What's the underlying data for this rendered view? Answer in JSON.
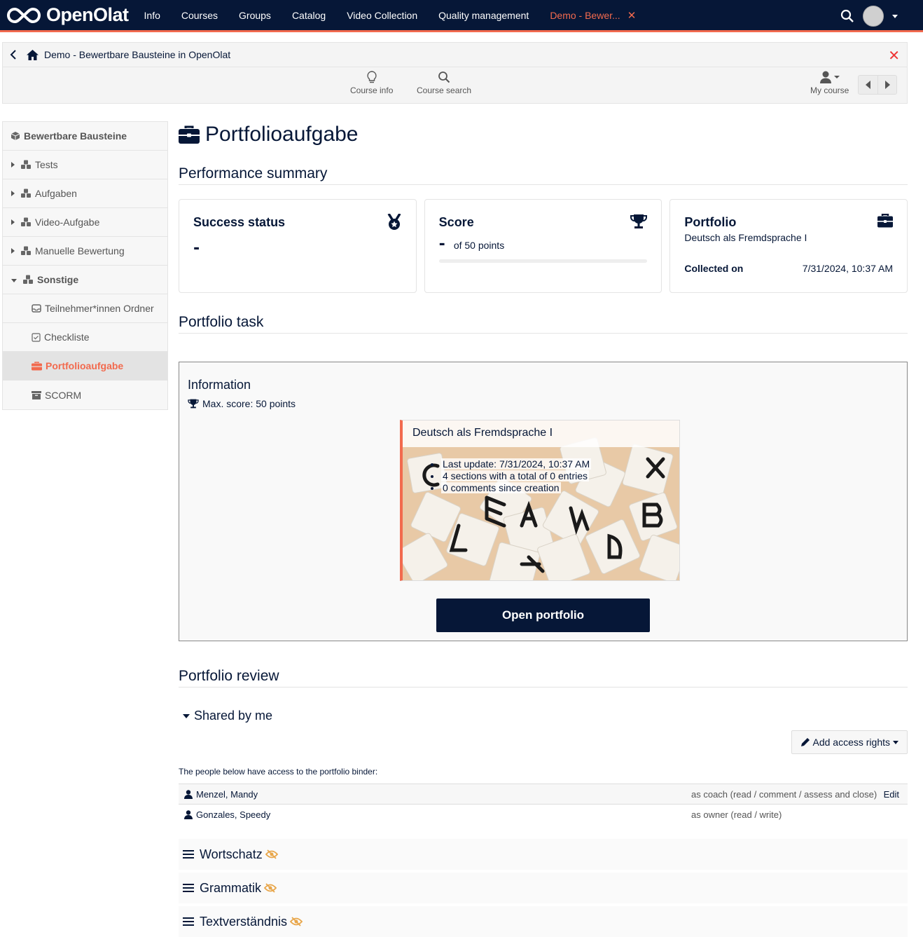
{
  "topnav": {
    "brand": "OpenOlat",
    "items": [
      {
        "label": "Info"
      },
      {
        "label": "Courses"
      },
      {
        "label": "Groups"
      },
      {
        "label": "Catalog"
      },
      {
        "label": "Video Collection"
      },
      {
        "label": "Quality management"
      }
    ],
    "active_tab": "Demo - Bewer...",
    "active_tab_close_icon": "close-icon",
    "accent_color": "#f26a4e",
    "bg_color": "#061737"
  },
  "toolbar": {
    "breadcrumb": "Demo - Bewertbare Bausteine in OpenOlat",
    "tools": [
      {
        "label": "Course info",
        "icon": "lightbulb-icon"
      },
      {
        "label": "Course search",
        "icon": "search-icon"
      }
    ],
    "my_course": "My course"
  },
  "sidebar": {
    "root": "Bewertbare Bausteine",
    "items": [
      {
        "label": "Tests",
        "expanded": false
      },
      {
        "label": "Aufgaben",
        "expanded": false
      },
      {
        "label": "Video-Aufgabe",
        "expanded": false
      },
      {
        "label": "Manuelle Bewertung",
        "expanded": false
      },
      {
        "label": "Sonstige",
        "expanded": true
      }
    ],
    "children": [
      {
        "label": "Teilnehmer*innen Ordner",
        "icon": "inbox-icon"
      },
      {
        "label": "Checkliste",
        "icon": "checkbox-icon"
      },
      {
        "label": "Portfolioaufgabe",
        "icon": "briefcase-icon",
        "active": true
      },
      {
        "label": "SCORM",
        "icon": "archive-icon"
      }
    ]
  },
  "main": {
    "title": "Portfolioaufgabe",
    "performance_heading": "Performance summary",
    "success_card": {
      "title": "Success status",
      "value": "-"
    },
    "score_card": {
      "title": "Score",
      "value": "-",
      "suffix": "of 50 points",
      "progress_percent": 0
    },
    "portfolio_card": {
      "title": "Portfolio",
      "subtitle": "Deutsch als Fremdsprache I",
      "collected_label": "Collected on",
      "collected_value": "7/31/2024, 10:37 AM"
    },
    "task_heading": "Portfolio task",
    "info": {
      "heading": "Information",
      "max_score": "Max. score: 50 points",
      "binder": {
        "title": "Deutsch als Fremdsprache I",
        "details": [
          "Last update: 7/31/2024, 10:37 AM",
          "4 sections with a total of 0 entries",
          "0 comments since creation"
        ]
      },
      "open_button": "Open portfolio"
    },
    "review_heading": "Portfolio review",
    "shared_by_me": "Shared by me",
    "add_access_rights": "Add access rights",
    "people_text": "The people below have access to the portfolio binder:",
    "people": [
      {
        "name": "Menzel, Mandy",
        "role": "as coach (read / comment / assess and close)",
        "action": "Edit"
      },
      {
        "name": "Gonzales, Speedy",
        "role": "as owner (read / write)",
        "action": ""
      }
    ],
    "sections": [
      {
        "title": "Wortschatz",
        "status_icon": "eye-slash-icon"
      },
      {
        "title": "Grammatik",
        "status_icon": "eye-slash-icon"
      },
      {
        "title": "Textverständnis",
        "status_icon": "eye-slash-icon"
      }
    ]
  }
}
